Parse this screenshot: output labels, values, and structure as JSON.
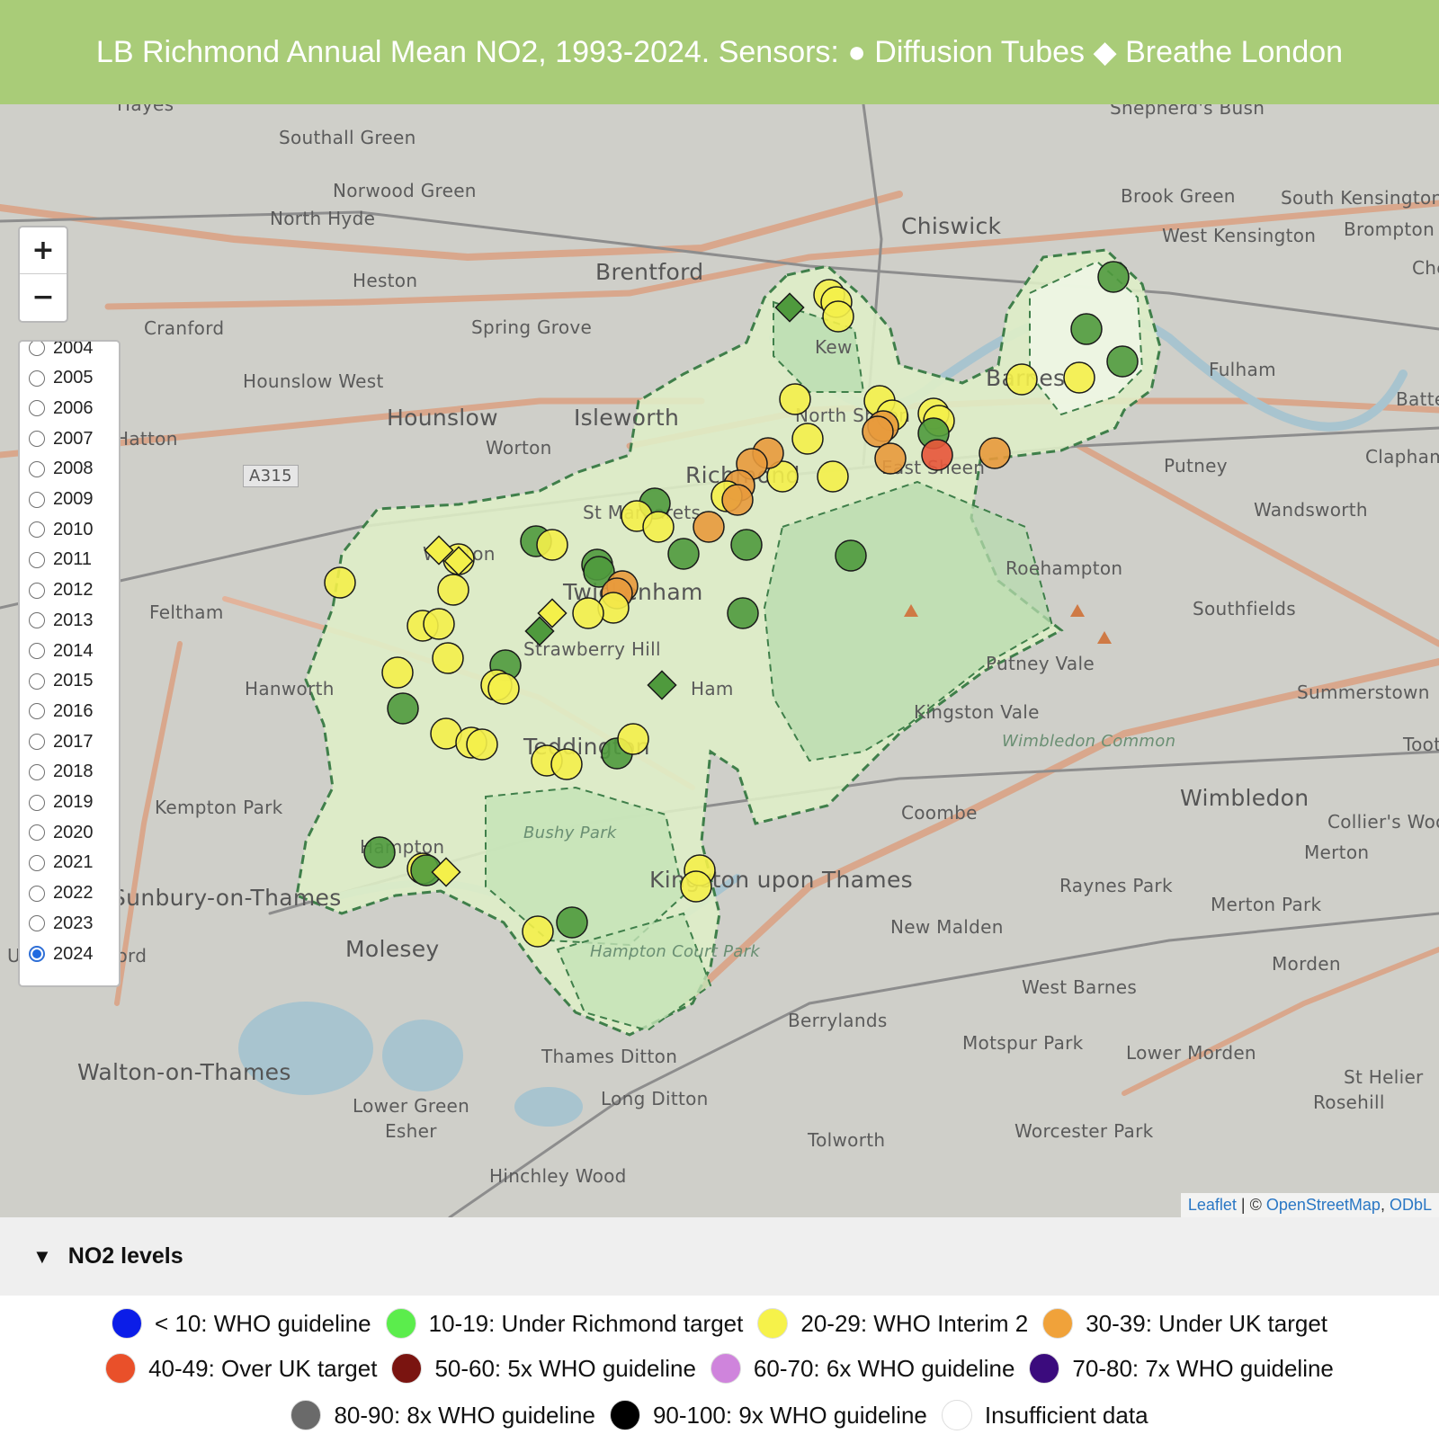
{
  "header": {
    "title": "LB Richmond Annual Mean NO2, 1993-2024. Sensors: ● Diffusion Tubes ◆ Breathe London"
  },
  "zoom": {
    "in_label": "+",
    "out_label": "−"
  },
  "years": {
    "visible": [
      "2004",
      "2005",
      "2006",
      "2007",
      "2008",
      "2009",
      "2010",
      "2011",
      "2012",
      "2013",
      "2014",
      "2015",
      "2016",
      "2017",
      "2018",
      "2019",
      "2020",
      "2021",
      "2022",
      "2023",
      "2024"
    ],
    "selected": "2024"
  },
  "places": [
    "Hayes",
    "Southall Green",
    "Norwood Green",
    "North Hyde",
    "Heston",
    "Cranford",
    "Hounslow West",
    "Hounslow",
    "Brentford",
    "Spring Grove",
    "Isleworth",
    "Worton",
    "Hatton",
    "Feltham",
    "Hanworth",
    "Kempton Park",
    "Sunbury-on-Thames",
    "Upper Halliford",
    "Walton-on-Thames",
    "Molesey",
    "Lower Green",
    "Esher",
    "Hinchley Wood",
    "Thames Ditton",
    "Long Ditton",
    "Chiswick",
    "Kew",
    "North Sheen",
    "East Sheen",
    "Richmond",
    "St Margarets",
    "Twickenham",
    "Whitton",
    "Strawberry Hill",
    "Ham",
    "Teddington",
    "Hampton",
    "Kingston upon Thames",
    "Bushy Park",
    "Hampton Court Park",
    "Barnes",
    "Putney",
    "Roehampton",
    "Putney Vale",
    "Kingston Vale",
    "Wimbledon Common",
    "Coombe",
    "New Malden",
    "Wimbledon",
    "Raynes Park",
    "West Barnes",
    "Berrylands",
    "Motspur Park",
    "Tolworth",
    "Worcester Park",
    "Shepherd's Bush",
    "Brook Green",
    "West Kensington",
    "South Kensington",
    "Brompton",
    "Chelsea",
    "Fulham",
    "Battersea",
    "Clapham",
    "Wandsworth",
    "Southfields",
    "Summerstown",
    "Tooting",
    "Collier's Wood",
    "Merton",
    "Merton Park",
    "Morden",
    "Lower Morden",
    "St Helier",
    "Rosehill",
    "A315"
  ],
  "attribution": {
    "leaflet": "Leaflet",
    "sep": " | © ",
    "osm": "OpenStreetMap",
    "comma": ", ",
    "odbl": "ODbL"
  },
  "legend": {
    "title": "NO2 levels",
    "arrow": "▼",
    "items": [
      {
        "label": "< 10: WHO guideline",
        "color": "#0b1de8"
      },
      {
        "label": "10-19: Under Richmond target",
        "color": "#5bed4c"
      },
      {
        "label": "20-29: WHO Interim 2",
        "color": "#f6f24a"
      },
      {
        "label": "30-39: Under UK target",
        "color": "#f0a23a"
      },
      {
        "label": "40-49: Over UK target",
        "color": "#e9502a"
      },
      {
        "label": "50-60: 5x WHO guideline",
        "color": "#7a1410"
      },
      {
        "label": "60-70: 6x WHO guideline",
        "color": "#cf84dc"
      },
      {
        "label": "70-80: 7x WHO guideline",
        "color": "#3b0b7d"
      },
      {
        "label": "80-90: 8x WHO guideline",
        "color": "#6a6a6a"
      },
      {
        "label": "90-100: 9x WHO guideline",
        "color": "#000000"
      },
      {
        "label": "Insufficient data",
        "color": "#ffffff"
      }
    ]
  },
  "marker_colors": {
    "green": "#4f9a3d",
    "yellow": "#f4f04a",
    "orange": "#e89a3c",
    "red": "#e8553a"
  }
}
